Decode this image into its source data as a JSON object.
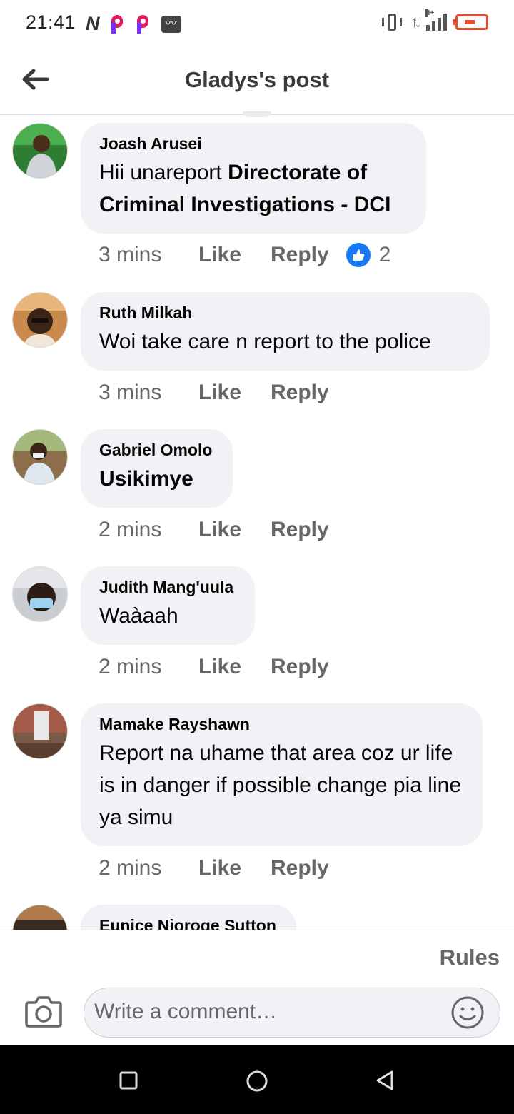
{
  "status_bar": {
    "time": "21:41",
    "n_icon": "N",
    "activity_icon": "activity-icon",
    "network_label": "H+"
  },
  "header": {
    "title": "Gladys's post",
    "back_icon": "arrow-left-icon"
  },
  "comments": [
    {
      "author": "Joash Arusei",
      "text_plain": "Hii unareport ",
      "text_bold": "Directorate of Criminal Investigations - DCI",
      "time": "3 mins",
      "like": "Like",
      "reply": "Reply",
      "reaction_count": "2",
      "reaction_icon": "like-thumb-icon"
    },
    {
      "author": "Ruth Milkah",
      "text_plain": "Woi take care n report to the police",
      "time": "3 mins",
      "like": "Like",
      "reply": "Reply"
    },
    {
      "author": "Gabriel Omolo",
      "text_bold": "Usikimye",
      "time": "2 mins",
      "like": "Like",
      "reply": "Reply"
    },
    {
      "author": "Judith Mang'uula",
      "text_plain": "Waàaah",
      "time": "2 mins",
      "like": "Like",
      "reply": "Reply"
    },
    {
      "author": "Mamake Rayshawn",
      "text_plain": "Report na uhame that area coz ur life is in danger if possible change pia line ya simu",
      "time": "2 mins",
      "like": "Like",
      "reply": "Reply"
    },
    {
      "author": "Eunice Njoroge Sutton"
    }
  ],
  "rules": {
    "label": "Rules"
  },
  "composer": {
    "placeholder": "Write a comment…",
    "camera_icon": "camera-icon",
    "emoji_icon": "emoji-icon"
  },
  "navbar": {
    "recents_icon": "square-icon",
    "home_icon": "circle-icon",
    "back_icon": "triangle-back-icon"
  },
  "colors": {
    "bubble": "#f0f2f5",
    "secondary_text": "#65676b",
    "facebook_blue": "#1877f2",
    "battery": "#e84b32"
  }
}
